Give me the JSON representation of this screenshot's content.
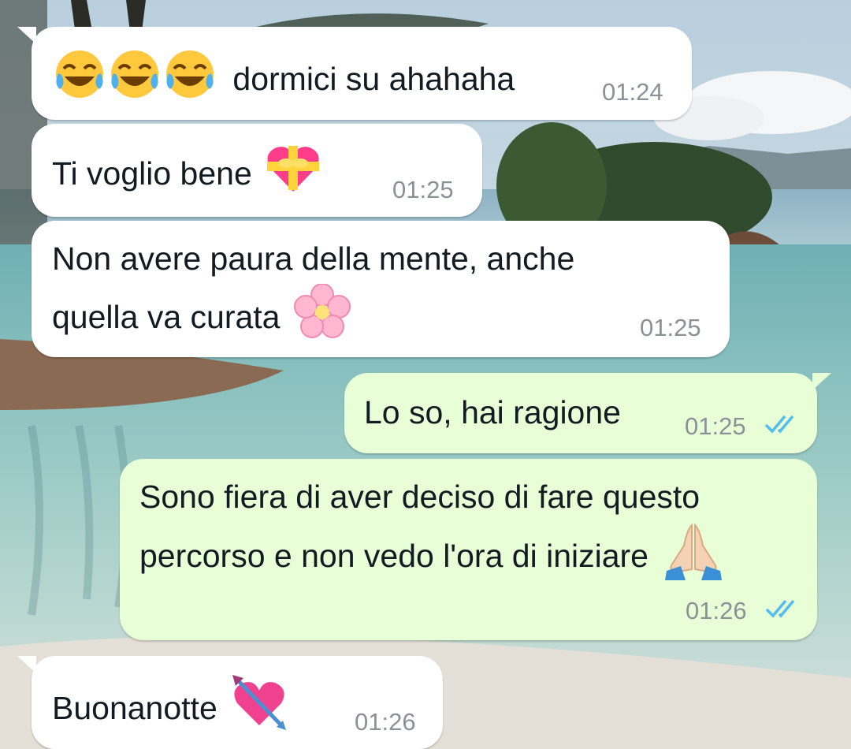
{
  "messages": [
    {
      "id": "m1",
      "direction": "incoming",
      "text": "dormici su ahahaha",
      "emoji_before": [
        "face-with-tears-of-joy",
        "face-with-tears-of-joy",
        "face-with-tears-of-joy"
      ],
      "time": "01:24"
    },
    {
      "id": "m2",
      "direction": "incoming",
      "text": "Ti voglio bene",
      "emoji_after": "heart-with-ribbon",
      "time": "01:25"
    },
    {
      "id": "m3",
      "direction": "incoming",
      "lines": [
        "Non avere paura della mente, anche",
        "quella va curata"
      ],
      "emoji_after": "cherry-blossom",
      "time": "01:25"
    },
    {
      "id": "m4",
      "direction": "outgoing",
      "text": "Lo so, hai ragione",
      "time": "01:25",
      "status": "read"
    },
    {
      "id": "m5",
      "direction": "outgoing",
      "lines": [
        "Sono fiera di aver deciso di fare questo",
        "percorso e non vedo l'ora di iniziare"
      ],
      "emoji_after": "folded-hands-light-skin",
      "time": "01:26",
      "status": "read"
    },
    {
      "id": "m6",
      "direction": "incoming",
      "text": "Buonanotte",
      "emoji_after": "heart-with-arrow",
      "time": "01:26"
    }
  ],
  "colors": {
    "incoming_bubble": "#ffffff",
    "outgoing_bubble": "#e7fed6",
    "text": "#111b21",
    "time": "#8a9197",
    "read_ticks": "#53bdeb"
  },
  "wallpaper": "resort-pool-with-palms-and-sea"
}
